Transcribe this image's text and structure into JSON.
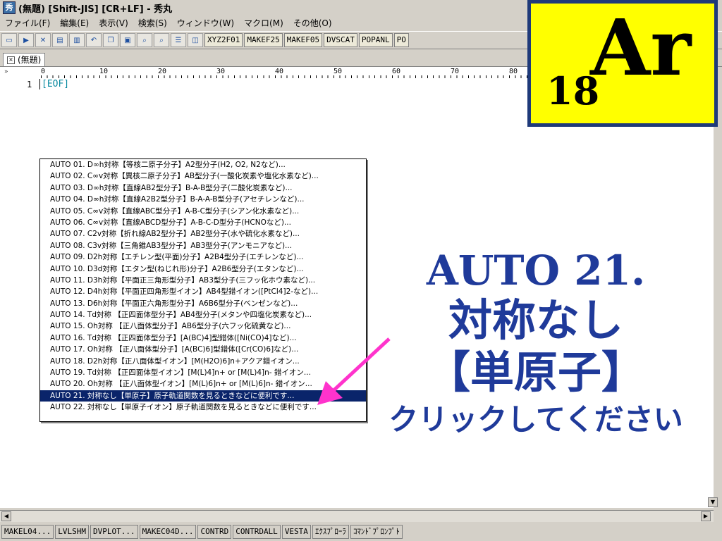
{
  "window": {
    "title": "(無題) [Shift-JIS] [CR+LF] - 秀丸",
    "icon": "hidemaru-app-icon"
  },
  "menu": [
    "ファイル(F)",
    "編集(E)",
    "表示(V)",
    "検索(S)",
    "ウィンドウ(W)",
    "マクロ(M)",
    "その他(O)"
  ],
  "toolbar": {
    "icons": [
      "new-file-icon",
      "open-file-icon",
      "close-file-icon",
      "save-icon",
      "save-as-icon",
      "undo-icon",
      "copy-icon",
      "paste-icon",
      "find-icon",
      "find-next-icon",
      "window-icon",
      "split-icon"
    ],
    "macros": [
      "XYZ2F01",
      "MAKEF25",
      "MAKEF05",
      "DVSCAT",
      "POPANL",
      "PO"
    ]
  },
  "tab": {
    "label": "(無題)"
  },
  "editor": {
    "ruler": [
      "0",
      "10",
      "20",
      "30",
      "40",
      "50",
      "60",
      "70",
      "80"
    ],
    "line_number": "1",
    "eof": "[EOF]"
  },
  "popup": {
    "selected_index": 20,
    "items": [
      "AUTO 01. D∞h対称【等核二原子分子】A2型分子(H2, O2, N2など)...",
      "AUTO 02. C∞v対称【異核二原子分子】AB型分子(一酸化炭素や塩化水素など)...",
      "AUTO 03. D∞h対称【直線AB2型分子】B-A-B型分子(二酸化炭素など)...",
      "AUTO 04. D∞h対称【直線A2B2型分子】B-A-A-B型分子(アセチレンなど)...",
      "AUTO 05. C∞v対称【直線ABC型分子】A-B-C型分子(シアン化水素など)...",
      "AUTO 06. C∞v対称【直線ABCD型分子】A-B-C-D型分子(HCNOなど)...",
      "AUTO 07. C2v対称【折れ線AB2型分子】AB2型分子(水や硫化水素など)...",
      "AUTO 08. C3v対称【三角錐AB3型分子】AB3型分子(アンモニアなど)...",
      "AUTO 09. D2h対称【エチレン型(平面)分子】A2B4型分子(エチレンなど)...",
      "AUTO 10. D3d対称【エタン型(ねじれ形)分子】A2B6型分子(エタンなど)...",
      "AUTO 11. D3h対称【平面正三角形型分子】AB3型分子(三フッ化ホウ素など)...",
      "AUTO 12. D4h対称【平面正四角形型イオン】AB4型錯イオン([PtCl4]2-など)...",
      "AUTO 13. D6h対称【平面正六角形型分子】A6B6型分子(ベンゼンなど)...",
      "AUTO 14. Td対称 【正四面体型分子】AB4型分子(メタンや四塩化炭素など)...",
      "AUTO 15. Oh対称 【正八面体型分子】AB6型分子(六フッ化硫黄など)...",
      "AUTO 16. Td対称 【正四面体型分子】[A(BC)4]型錯体([Ni(CO)4]など)...",
      "AUTO 17. Oh対称 【正八面体型分子】[A(BC)6]型錯体([Cr(CO)6]など)...",
      "AUTO 18. D2h対称【正八面体型イオン】[M(H2O)6]n+アクア錯イオン...",
      "AUTO 19. Td対称 【正四面体型イオン】[M(L)4]n+ or [M(L)4]n- 錯イオン...",
      "AUTO 20. Oh対称 【正八面体型イオン】[M(L)6]n+ or [M(L)6]n- 錯イオン...",
      "AUTO 21. 対称なし【単原子】原子軌道関数を見るときなどに便利です...",
      "AUTO 22. 対称なし【単原子イオン】原子軌道関数を見るときなどに便利です..."
    ]
  },
  "element_badge": {
    "number": "18",
    "symbol": "Ar",
    "background": "#ffff00",
    "border": "#1f3a7a"
  },
  "annotation": {
    "line1": "AUTO 21.",
    "line2": "対称なし",
    "line3": "【単原子】",
    "line4": "クリックしてください",
    "color": "#1f3a9a",
    "arrow_color": "#ff33cc"
  },
  "statusbar": [
    "MAKEL04...",
    "LVLSHM",
    "DVPLOT...",
    "MAKEC04D...",
    "CONTRD",
    "CONTRDALL",
    "VESTA",
    "ｴｸｽﾌﾟﾛｰﾗ",
    "ｺﾏﾝﾄﾞﾌﾟﾛﾝﾌﾟﾄ"
  ]
}
